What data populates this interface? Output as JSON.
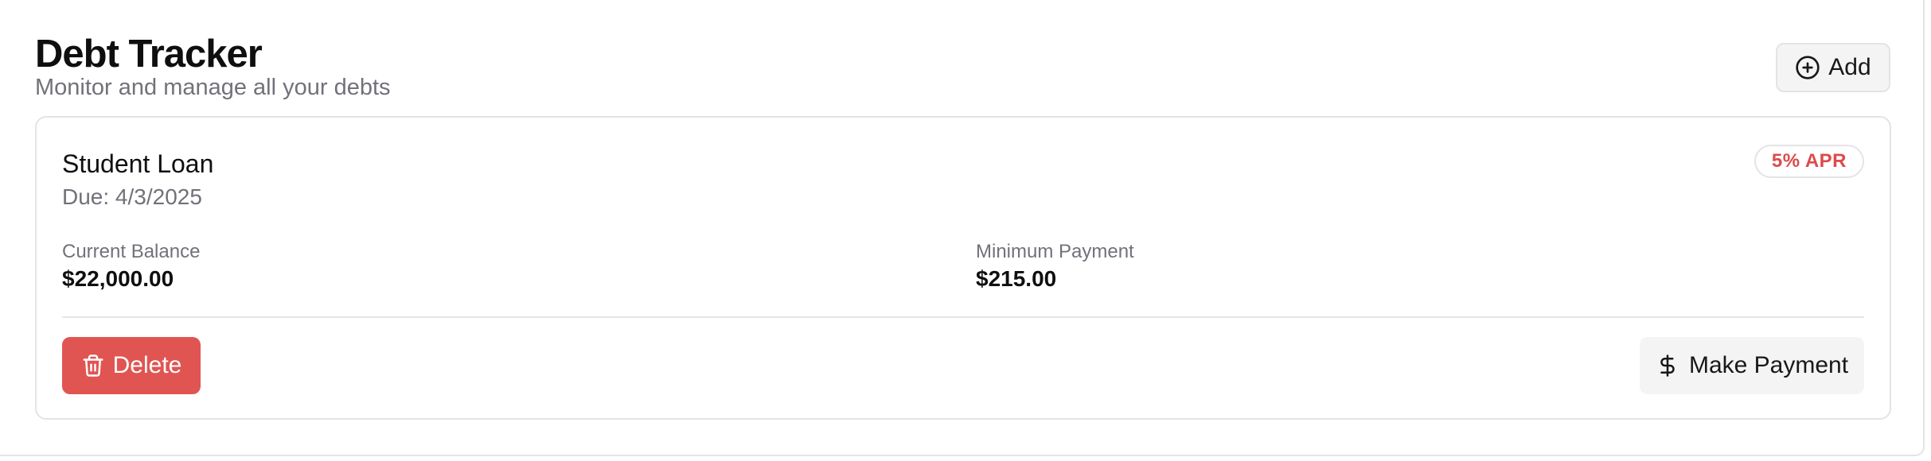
{
  "header": {
    "title": "Debt Tracker",
    "subtitle": "Monitor and manage all your debts",
    "add_label": "Add",
    "add_icon": "plus-circle-icon"
  },
  "debts": [
    {
      "name": "Student Loan",
      "due": "Due: 4/3/2025",
      "apr_badge": "5% APR",
      "balance_label": "Current Balance",
      "balance_value": "$22,000.00",
      "min_payment_label": "Minimum Payment",
      "min_payment_value": "$215.00",
      "delete_label": "Delete",
      "delete_icon": "trash-icon",
      "pay_label": "Make Payment",
      "pay_icon": "dollar-icon"
    }
  ],
  "colors": {
    "danger": "#e05552",
    "apr_text": "#dc4b4b",
    "muted_text": "#71717a",
    "border": "#e4e4e7",
    "secondary_bg": "#f4f4f5"
  }
}
